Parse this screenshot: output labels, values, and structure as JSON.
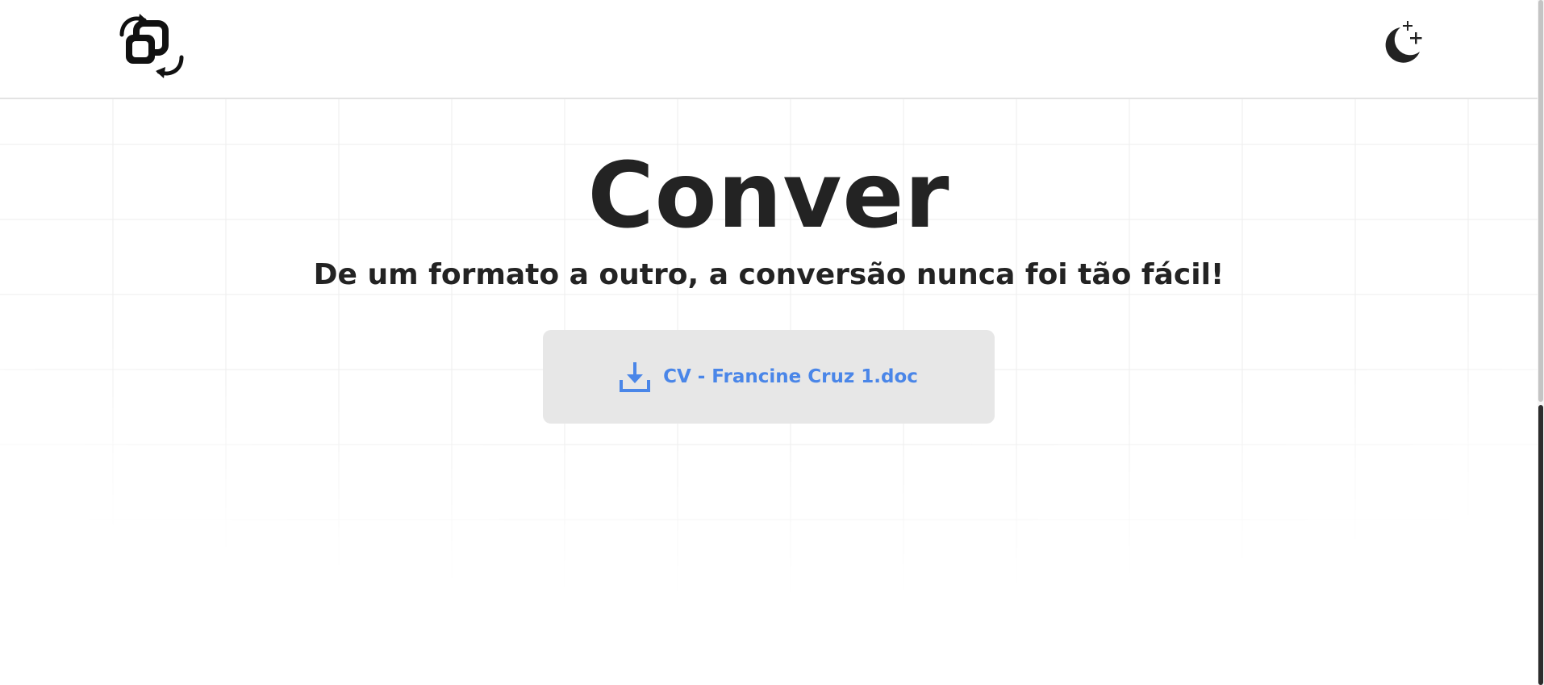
{
  "header": {
    "logo": {
      "icon": "convert-logo-icon"
    },
    "theme_toggle": {
      "icon": "moon-stars-icon"
    }
  },
  "main": {
    "title": "Conver",
    "subtitle": "De um formato a outro, a conversão nunca foi tão fácil!",
    "download": {
      "icon": "download-icon",
      "file_name": "CV - Francine Cruz 1.doc"
    }
  },
  "colors": {
    "text": "#232323",
    "accent": "#4a86e8",
    "download_box_bg": "#e7e7e7",
    "grid_line": "#ececec",
    "header_border": "#e3e3e3"
  }
}
